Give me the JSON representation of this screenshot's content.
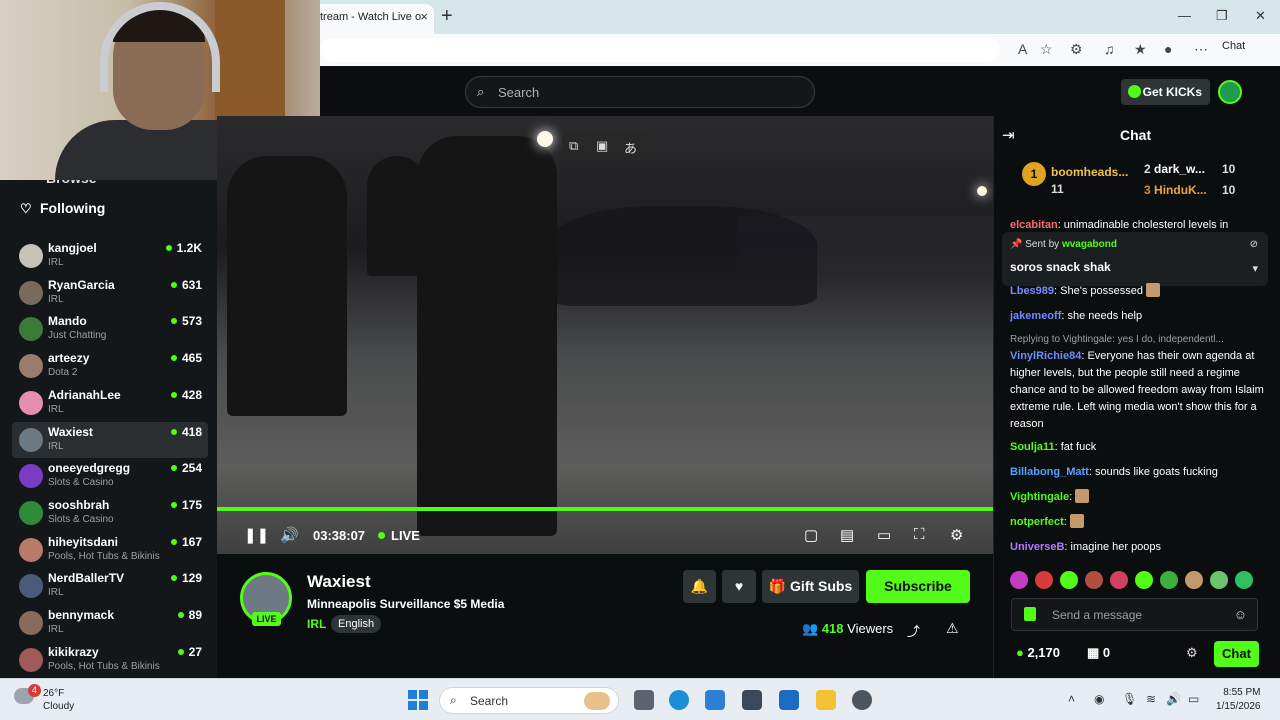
{
  "browser": {
    "tab_title": "tream - Watch Live o",
    "tab_close": "×",
    "new_tab": "+",
    "window_controls": [
      "—",
      "❐",
      "✕"
    ],
    "chat_button": "Chat"
  },
  "header": {
    "search_placeholder": "Search",
    "get_kicks": "Get KICKs"
  },
  "sidebar": {
    "browse_label": "Browse",
    "following_label": "Following",
    "channels": [
      {
        "name": "kangjoel",
        "category": "IRL",
        "viewers": "1.2K",
        "color": "#c7c2b8"
      },
      {
        "name": "RyanGarcia",
        "category": "IRL",
        "viewers": "631",
        "color": "#7a6a5b"
      },
      {
        "name": "Mando",
        "category": "Just Chatting",
        "viewers": "573",
        "color": "#3a7b3a"
      },
      {
        "name": "arteezy",
        "category": "Dota 2",
        "viewers": "465",
        "color": "#9a7b6c"
      },
      {
        "name": "AdrianahLee",
        "category": "IRL",
        "viewers": "428",
        "color": "#e48fb0"
      },
      {
        "name": "Waxiest",
        "category": "IRL",
        "viewers": "418",
        "color": "#6d7a84"
      },
      {
        "name": "oneeyedgregg",
        "category": "Slots & Casino",
        "viewers": "254",
        "color": "#7a3cc4"
      },
      {
        "name": "sooshbrah",
        "category": "Slots & Casino",
        "viewers": "175",
        "color": "#2f8a3a"
      },
      {
        "name": "hiheyitsdani",
        "category": "Pools, Hot Tubs & Bikinis",
        "viewers": "167",
        "color": "#b87b6a"
      },
      {
        "name": "NerdBallerTV",
        "category": "IRL",
        "viewers": "129",
        "color": "#4b5a7a"
      },
      {
        "name": "bennymack",
        "category": "IRL",
        "viewers": "89",
        "color": "#8a6b5a"
      },
      {
        "name": "kikikrazy",
        "category": "Pools, Hot Tubs & Bikinis",
        "viewers": "27",
        "color": "#a05a5a"
      }
    ]
  },
  "player": {
    "time": "03:38:07",
    "live_label": "LIVE",
    "progress": 1.0
  },
  "stream": {
    "streamer": "Waxiest",
    "live_tag": "LIVE",
    "title": "Minneapolis Surveillance $5 Media",
    "category": "IRL",
    "language": "English",
    "gift_subs": "Gift Subs",
    "subscribe": "Subscribe",
    "viewer_count": "418",
    "viewers_label": "Viewers"
  },
  "chat": {
    "title": "Chat",
    "leaderboard": [
      {
        "rank": "1",
        "name": "boomheads...",
        "count": "11"
      },
      {
        "rank": "2",
        "name": "dark_w...",
        "count": "10"
      },
      {
        "rank": "3",
        "name": "HinduK...",
        "count": "10"
      }
    ],
    "partial_top": {
      "user": "elcabitan",
      "text": ": unimadinable cholesterol levels in"
    },
    "pinned": {
      "sent_by_label": "Sent by",
      "sender": "wvagabond",
      "message": "soros snack shak"
    },
    "messages": [
      {
        "user": "Lbes989",
        "color": "#7b8cff",
        "text": ": She's possessed",
        "emote": true
      },
      {
        "user": "jakemeoff",
        "color": "#6c8cff",
        "text": ": she needs help",
        "emote": false
      },
      {
        "reply": "Replying to Vightingale: yes I do, independentl...",
        "user": "VinylRichie84",
        "color": "#6c8cff",
        "text": ": Everyone has their own agenda at higher levels, but the people still need a regime chance and to be allowed freedom away from Islaim extreme rule. Left wing media won't show this for a reason"
      },
      {
        "user": "Soulja11",
        "color": "#53fc18",
        "text": ": fat fuck"
      },
      {
        "user": "Billabong_Matt",
        "color": "#5aa0ff",
        "text": ": sounds like goats fucking"
      },
      {
        "user": "Vightingale",
        "color": "#53fc18",
        "text": ":"
      },
      {
        "user": "notperfect",
        "color": "#53fc18",
        "text": ":"
      },
      {
        "user": "UniverseB",
        "color": "#b07cff",
        "text": ": imagine her poops"
      }
    ],
    "input_placeholder": "Send a message",
    "points": "2,170",
    "redeems": "0",
    "send_label": "Chat"
  },
  "taskbar": {
    "temp": "26°F",
    "weather": "Cloudy",
    "weather_badge": "4",
    "search": "Search",
    "time": "8:55 PM",
    "date": "1/15/2026"
  },
  "colors": {
    "accent": "#53fc18",
    "bg": "#0b0e0f",
    "panel": "#141719"
  }
}
